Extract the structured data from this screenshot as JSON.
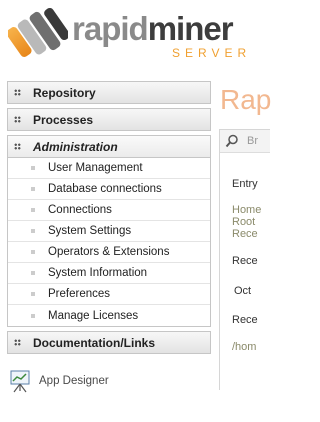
{
  "logo": {
    "word_part1": "rapid",
    "word_part2": "miner",
    "subtitle": "SERVER"
  },
  "nav": {
    "sections": [
      {
        "label": "Repository"
      },
      {
        "label": "Processes"
      },
      {
        "label": "Administration"
      },
      {
        "label": "Documentation/Links"
      }
    ],
    "admin_items": [
      {
        "label": "User Management"
      },
      {
        "label": "Database connections"
      },
      {
        "label": "Connections"
      },
      {
        "label": "System Settings"
      },
      {
        "label": "Operators & Extensions"
      },
      {
        "label": "System Information"
      },
      {
        "label": "Preferences"
      },
      {
        "label": "Manage Licenses"
      }
    ]
  },
  "app_designer": {
    "label": "App Designer"
  },
  "main": {
    "title": "Rap",
    "search_placeholder": "Br",
    "lines": [
      "Entry",
      "Home",
      "Root",
      "Rece",
      "Rece",
      "Oct",
      "Rece",
      "/hom"
    ]
  }
}
